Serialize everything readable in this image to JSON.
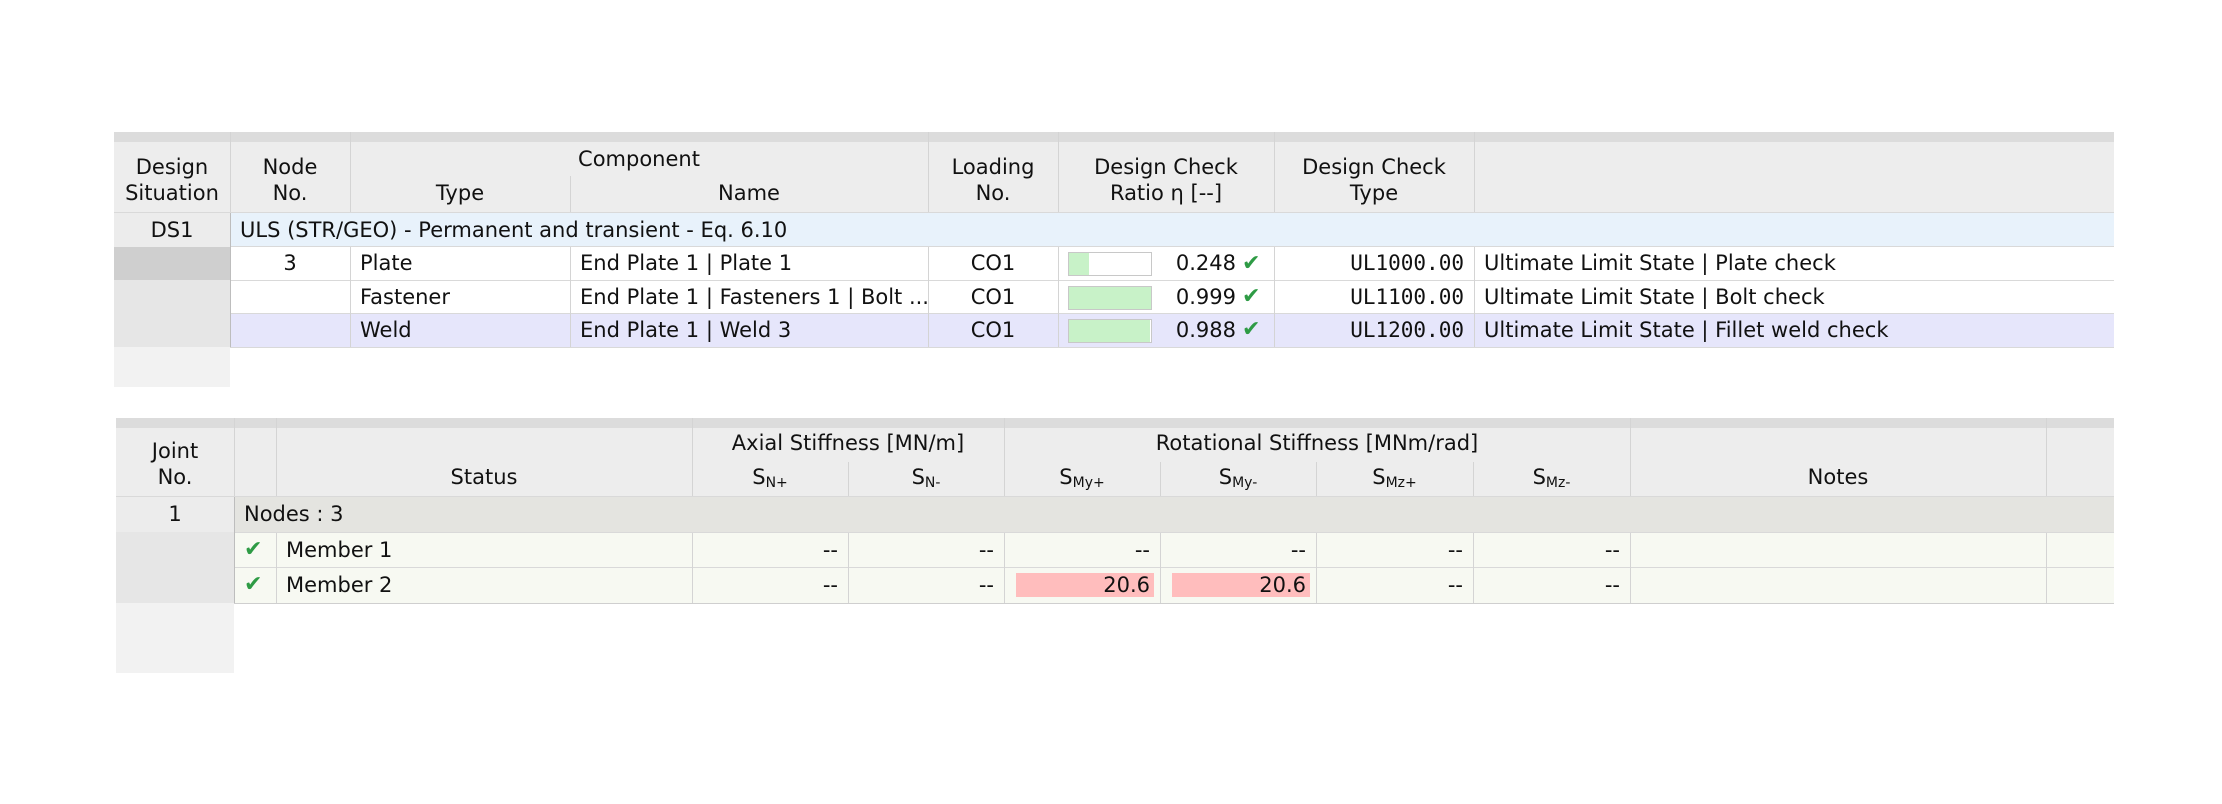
{
  "table1": {
    "headers": {
      "design_situation": [
        "Design",
        "Situation"
      ],
      "node_no": [
        "Node",
        "No."
      ],
      "component": "Component",
      "type": "Type",
      "name": "Name",
      "loading_no": [
        "Loading",
        "No."
      ],
      "design_check_ratio": [
        "Design Check",
        "Ratio η [--]"
      ],
      "design_check_type": [
        "Design Check",
        "Type"
      ]
    },
    "group": {
      "id": "DS1",
      "label": "ULS (STR/GEO) - Permanent and transient - Eq. 6.10"
    },
    "rows": [
      {
        "node": "3",
        "type": "Plate",
        "name": "End Plate 1 | Plate 1",
        "loading": "CO1",
        "ratio": "0.248",
        "ratio_value": 0.248,
        "check_type": "UL1000.00",
        "description": "Ultimate Limit State | Plate check"
      },
      {
        "node": "",
        "type": "Fastener",
        "name": "End Plate 1 | Fasteners 1 | Bolt ...",
        "loading": "CO1",
        "ratio": "0.999",
        "ratio_value": 0.999,
        "check_type": "UL1100.00",
        "description": "Ultimate Limit State | Bolt check"
      },
      {
        "node": "",
        "type": "Weld",
        "name": "End Plate 1 | Weld 3",
        "loading": "CO1",
        "ratio": "0.988",
        "ratio_value": 0.988,
        "check_type": "UL1200.00",
        "description": "Ultimate Limit State | Fillet weld check"
      }
    ],
    "colors": {
      "bar_fill": "#c8f2c8",
      "check_green": "#2e9b45",
      "group_row": "#e8f2fb",
      "selected_row": "#e6e6fb"
    }
  },
  "table2": {
    "headers": {
      "joint_no": [
        "Joint",
        "No."
      ],
      "status": "Status",
      "axial_stiffness": "Axial Stiffness [MN/m]",
      "rotational_stiffness": "Rotational Stiffness [MNm/rad]",
      "s_n_plus": {
        "base": "S",
        "sub": "N+"
      },
      "s_n_minus": {
        "base": "S",
        "sub": "N-"
      },
      "s_my_plus": {
        "base": "S",
        "sub": "My+"
      },
      "s_my_minus": {
        "base": "S",
        "sub": "My-"
      },
      "s_mz_plus": {
        "base": "S",
        "sub": "Mz+"
      },
      "s_mz_minus": {
        "base": "S",
        "sub": "Mz-"
      },
      "notes": "Notes"
    },
    "group": {
      "id": "1",
      "label": "Nodes : 3"
    },
    "rows": [
      {
        "name": "Member 1",
        "sn_plus": "--",
        "sn_minus": "--",
        "smy_plus": "--",
        "smy_minus": "--",
        "smz_plus": "--",
        "smz_minus": "--",
        "notes": ""
      },
      {
        "name": "Member 2",
        "sn_plus": "--",
        "sn_minus": "--",
        "smy_plus": "20.6",
        "smy_minus": "20.6",
        "smz_plus": "--",
        "smz_minus": "--",
        "notes": ""
      }
    ],
    "colors": {
      "highlight": "#ffbdbd",
      "group_row": "#e4e4e0",
      "row_bg": "#f7f9f2"
    }
  }
}
